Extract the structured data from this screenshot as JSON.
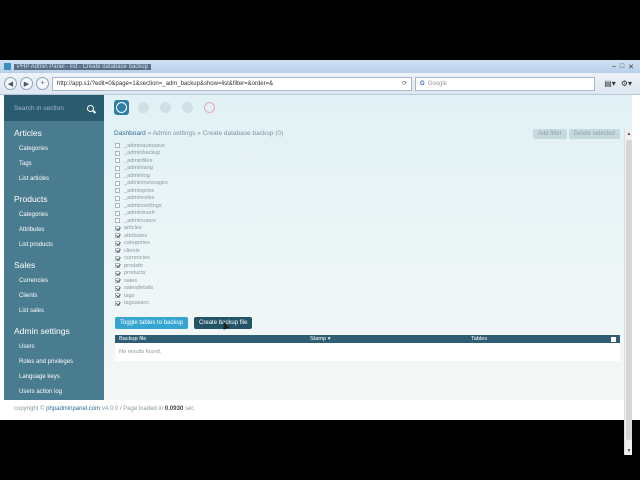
{
  "browser": {
    "title": "PHP Admin Panel - list - Create database backup",
    "url": "http://app.s1/?edit=0&page=1&section=_adm_backup&show=list&filter=&order=&",
    "search_placeholder": "Google",
    "back": "◀",
    "forward": "▶",
    "plus": "+",
    "refresh": "⟳",
    "page_menu": "▤▾",
    "tools_menu": "⚙▾",
    "min": "–",
    "max": "□",
    "close": "✕"
  },
  "sidebar": {
    "search_placeholder": "Search in section",
    "sections": [
      {
        "title": "Articles",
        "items": [
          "Categories",
          "Tags",
          "List articles"
        ]
      },
      {
        "title": "Products",
        "items": [
          "Categories",
          "Attributes",
          "List products"
        ]
      },
      {
        "title": "Sales",
        "items": [
          "Currencies",
          "Clients",
          "List sales"
        ]
      },
      {
        "title": "Admin settings",
        "items": [
          "Users",
          "Roles and privileges",
          "Language keys",
          "Users action log"
        ]
      }
    ]
  },
  "toolbar_icons": [
    "power-icon",
    "dashboard-icon",
    "user-icon",
    "mail-icon",
    "logout-icon"
  ],
  "breadcrumb": {
    "dashboard": "Dashboard",
    "admin_settings": "Admin settings",
    "sep": "»",
    "current": "Create database backup (0)"
  },
  "header_buttons": {
    "add_filter": "Add filter",
    "delete_selected": "Delete selected"
  },
  "tables": [
    {
      "name": "_adminautosave",
      "checked": false
    },
    {
      "name": "_adminbackup",
      "checked": false
    },
    {
      "name": "_adminfiles",
      "checked": false
    },
    {
      "name": "_adminlang",
      "checked": false
    },
    {
      "name": "_adminlog",
      "checked": false
    },
    {
      "name": "_adminmessages",
      "checked": false
    },
    {
      "name": "_adminprivs",
      "checked": false
    },
    {
      "name": "_adminroles",
      "checked": false
    },
    {
      "name": "_adminsettings",
      "checked": false
    },
    {
      "name": "_admintrash",
      "checked": false
    },
    {
      "name": "_adminusers",
      "checked": false
    },
    {
      "name": "articles",
      "checked": true
    },
    {
      "name": "attributes",
      "checked": true
    },
    {
      "name": "categories",
      "checked": true
    },
    {
      "name": "clients",
      "checked": true
    },
    {
      "name": "currencies",
      "checked": true
    },
    {
      "name": "prodattr",
      "checked": true
    },
    {
      "name": "products",
      "checked": true
    },
    {
      "name": "sales",
      "checked": true
    },
    {
      "name": "salesdetails",
      "checked": true
    },
    {
      "name": "tags",
      "checked": true
    },
    {
      "name": "tagsassoc",
      "checked": true
    }
  ],
  "buttons": {
    "toggle": "Toggle tables to backup",
    "create": "Create backup file"
  },
  "backup_table": {
    "columns": {
      "file": "Backup file",
      "stamp": "Stamp ▾",
      "tables": "Tables"
    },
    "empty": "No results found."
  },
  "footer": {
    "copyright": "copyright ©",
    "site": "phpadminpanel.com",
    "version": "v4.0.0 / Page loaded in",
    "time": "0.0930",
    "unit": "sec"
  },
  "colors": {
    "sidebar": "#4a7c8f",
    "sidebar_dark": "#2b5b6f",
    "accent": "#36a6d1",
    "table_header": "#2e5e73"
  }
}
